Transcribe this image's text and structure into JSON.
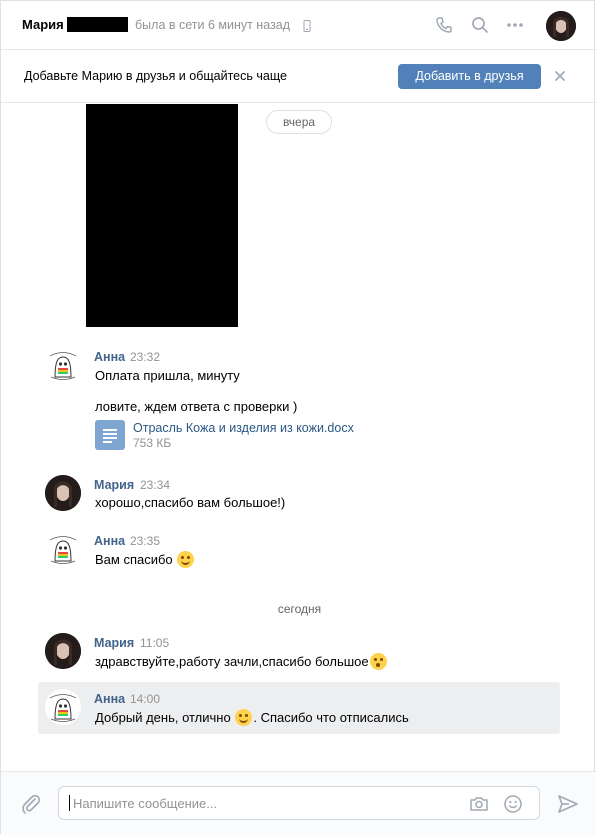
{
  "header": {
    "name": "Мария",
    "status": "была в сети 6 минут назад",
    "icons": [
      "phone-icon",
      "search-icon",
      "more-icon",
      "avatar"
    ]
  },
  "banner": {
    "text": "Добавьте Марию в друзья и общайтесь чаще",
    "button": "Добавить в друзья",
    "close": "close-icon"
  },
  "dates": {
    "yesterday": "вчера",
    "today": "сегодня"
  },
  "messages": [
    {
      "author": "Анна",
      "time": "23:32",
      "lines": [
        "Оплата пришла, минуту",
        "ловите, ждем ответа с проверки )"
      ],
      "attachment": {
        "title": "Отрасль Кожа и изделия из кожи.docx",
        "size": "753 КБ"
      }
    },
    {
      "author": "Мария",
      "time": "23:34",
      "text": "хорошо,спасибо вам большое!)"
    },
    {
      "author": "Анна",
      "time": "23:35",
      "text": "Вам спасибо"
    },
    {
      "author": "Мария",
      "time": "11:05",
      "text": "здравствуйте,работу зачли,спасибо большое"
    },
    {
      "author": "Анна",
      "time": "14:00",
      "text_before": "Добрый день, отлично",
      "text_after": ". Спасибо что отписались"
    }
  ],
  "composer": {
    "placeholder": "Напишите сообщение...",
    "icons": [
      "paperclip-icon",
      "camera-icon",
      "smile-icon",
      "send-icon"
    ]
  },
  "colors": {
    "accent": "#5181b8",
    "link": "#2a5885",
    "author": "#42648b",
    "muted": "#939393",
    "highlight": "#edeef0"
  }
}
